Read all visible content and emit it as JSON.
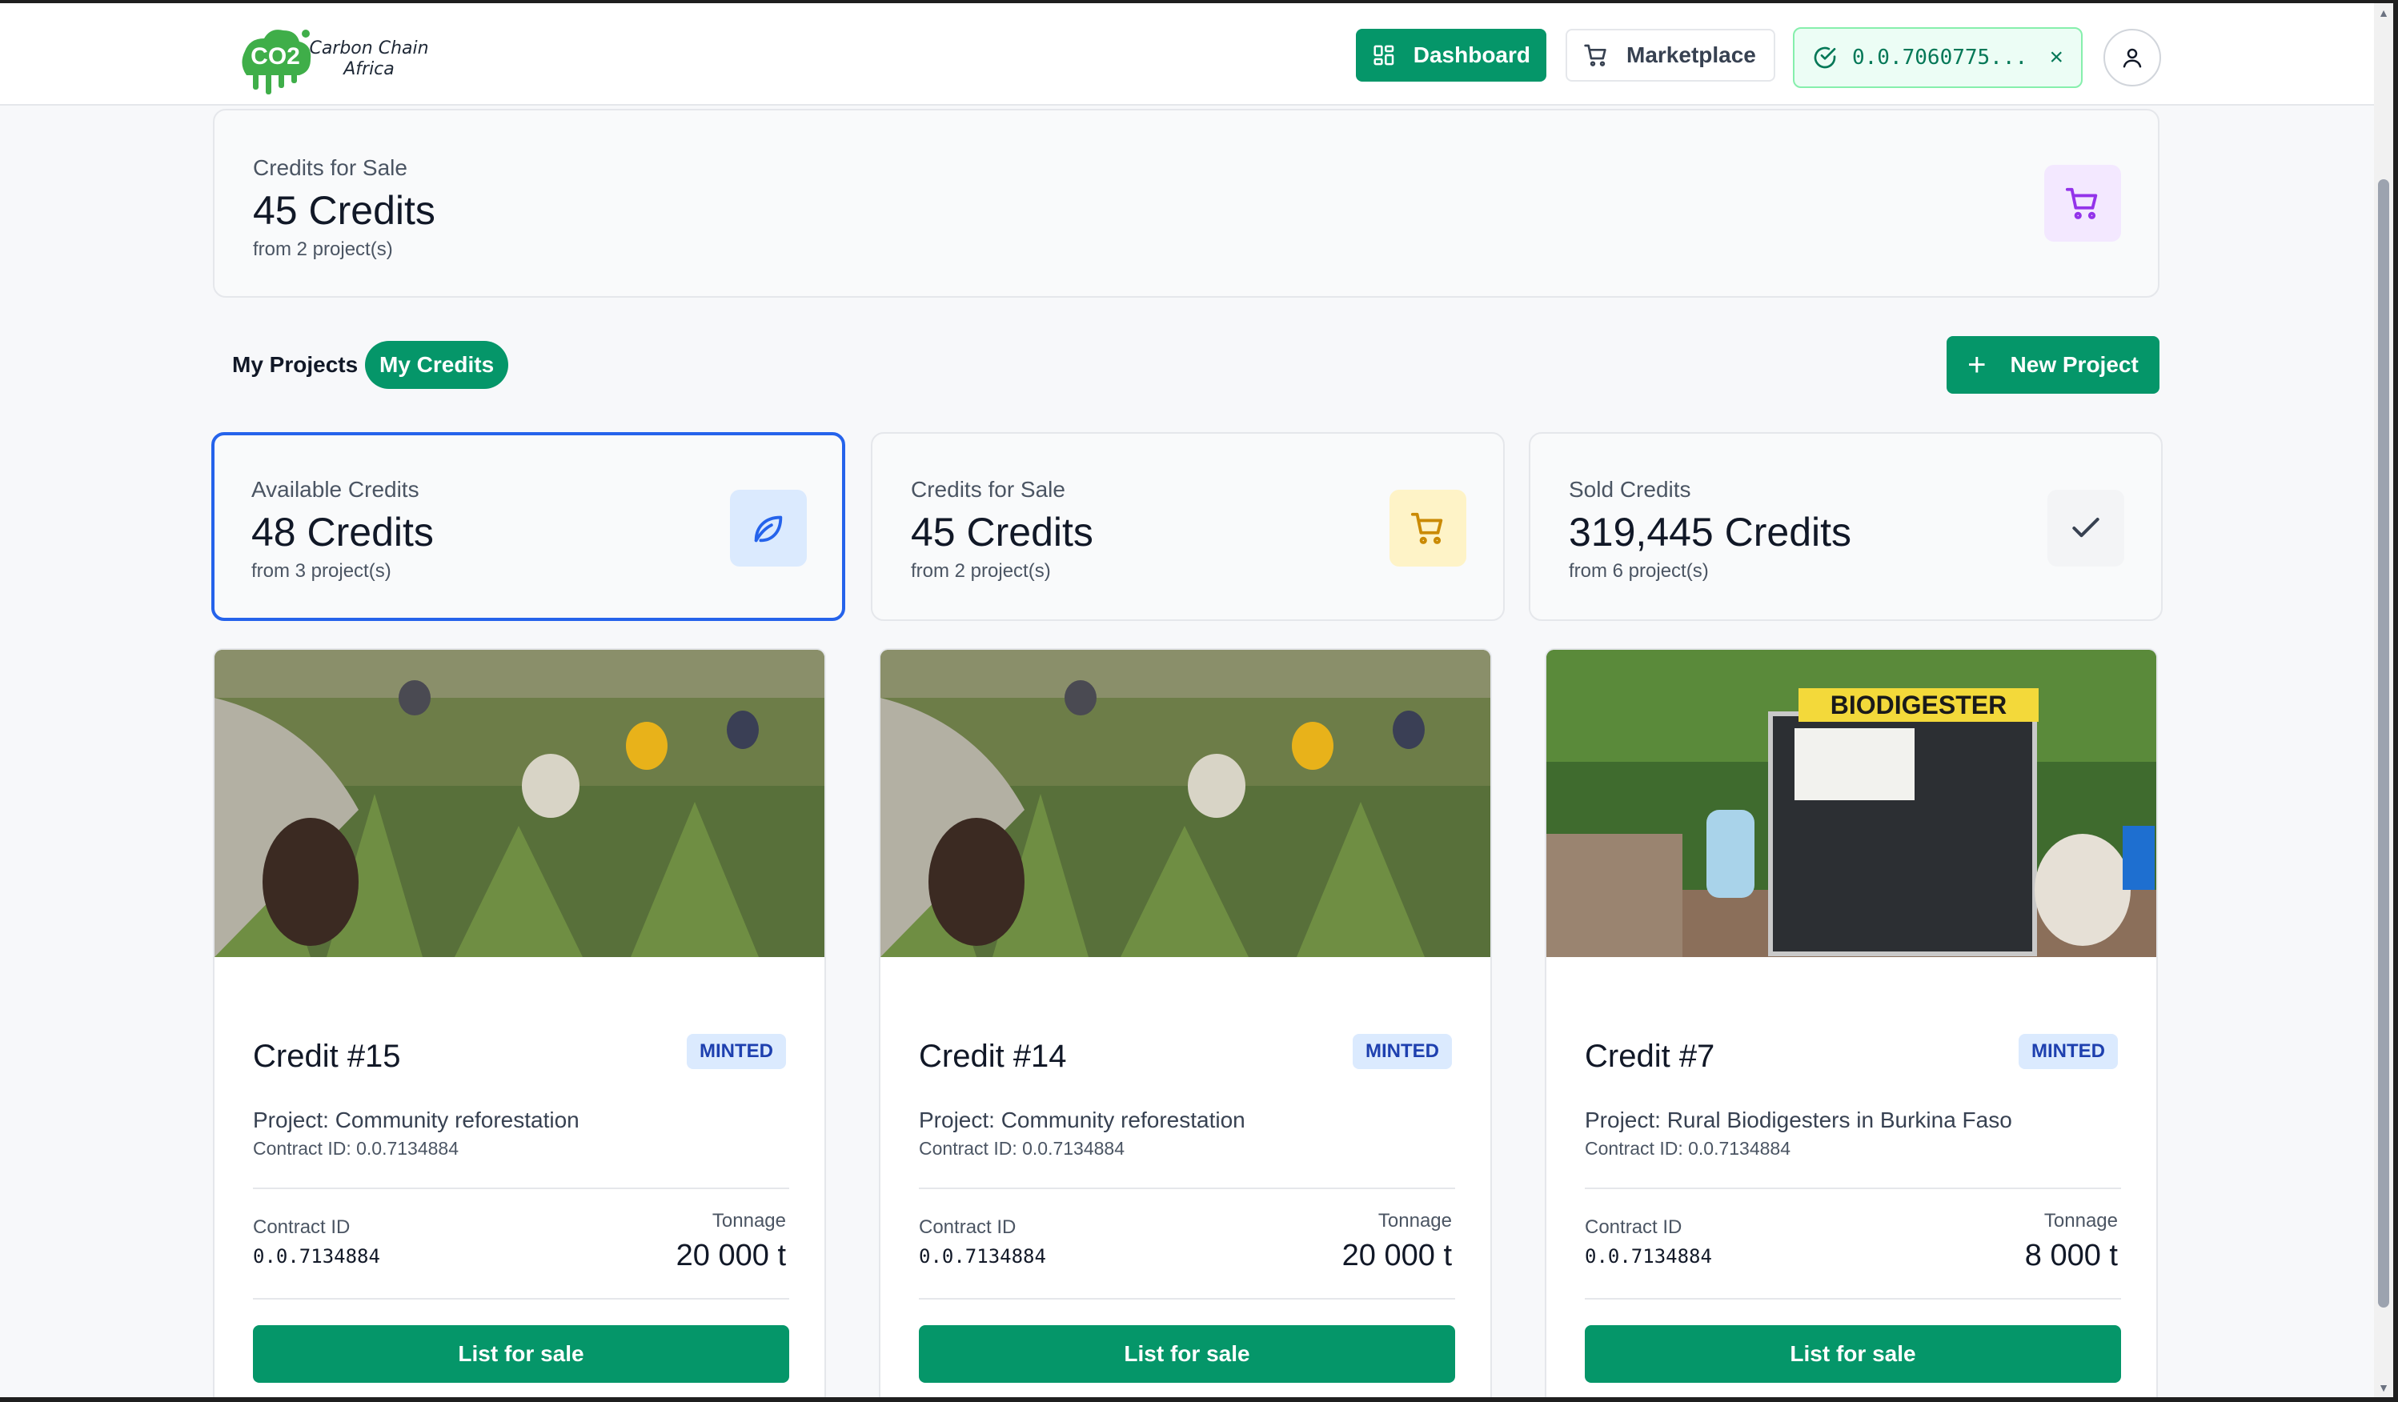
{
  "brand": {
    "logo_mark": "CO2",
    "name_line1": "Carbon Chain",
    "name_line2": "Africa"
  },
  "nav": {
    "dashboard_label": "Dashboard",
    "marketplace_label": "Marketplace",
    "wallet_id": "0.0.7060775...",
    "wallet_close": "×"
  },
  "summary_top": {
    "label": "Credits for Sale",
    "value": "45 Credits",
    "sub": "from 2 project(s)",
    "icon": "cart-icon"
  },
  "tabs": [
    {
      "label": "My Projects"
    },
    {
      "label": "My Credits",
      "active": true
    }
  ],
  "new_project_label": "New Project",
  "stats": [
    {
      "label": "Available Credits",
      "value": "48 Credits",
      "sub": "from 3 project(s)",
      "icon": "leaf-icon",
      "accent": "#2563eb"
    },
    {
      "label": "Credits for Sale",
      "value": "45 Credits",
      "sub": "from 2 project(s)",
      "icon": "cart-icon",
      "accent": "#ca8a04"
    },
    {
      "label": "Sold Credits",
      "value": "319,445 Credits",
      "sub": "from 6 project(s)",
      "icon": "check-icon",
      "accent": "#374151"
    }
  ],
  "credits": [
    {
      "title": "Credit #15",
      "badge": "MINTED",
      "project": "Project: Community reforestation",
      "contract_small": "Contract ID: 0.0.7134884",
      "contract_label": "Contract ID",
      "contract_id": "0.0.7134884",
      "tonnage_label": "Tonnage",
      "tonnage": "20 000 t",
      "button": "List for sale",
      "image": "reforestation-photo"
    },
    {
      "title": "Credit #14",
      "badge": "MINTED",
      "project": "Project: Community reforestation",
      "contract_small": "Contract ID: 0.0.7134884",
      "contract_label": "Contract ID",
      "contract_id": "0.0.7134884",
      "tonnage_label": "Tonnage",
      "tonnage": "20 000 t",
      "button": "List for sale",
      "image": "reforestation-photo"
    },
    {
      "title": "Credit #7",
      "badge": "MINTED",
      "project": "Project: Rural Biodigesters in Burkina Faso",
      "contract_small": "Contract ID: 0.0.7134884",
      "contract_label": "Contract ID",
      "contract_id": "0.0.7134884",
      "tonnage_label": "Tonnage",
      "tonnage": "8 000 t",
      "button": "List for sale",
      "image": "biodigester-photo",
      "image_sign": "BIODIGESTER"
    }
  ],
  "colors": {
    "primary": "#059669",
    "badge_bg": "#dbeafe",
    "badge_text": "#1e40af",
    "selected_border": "#2563eb"
  }
}
